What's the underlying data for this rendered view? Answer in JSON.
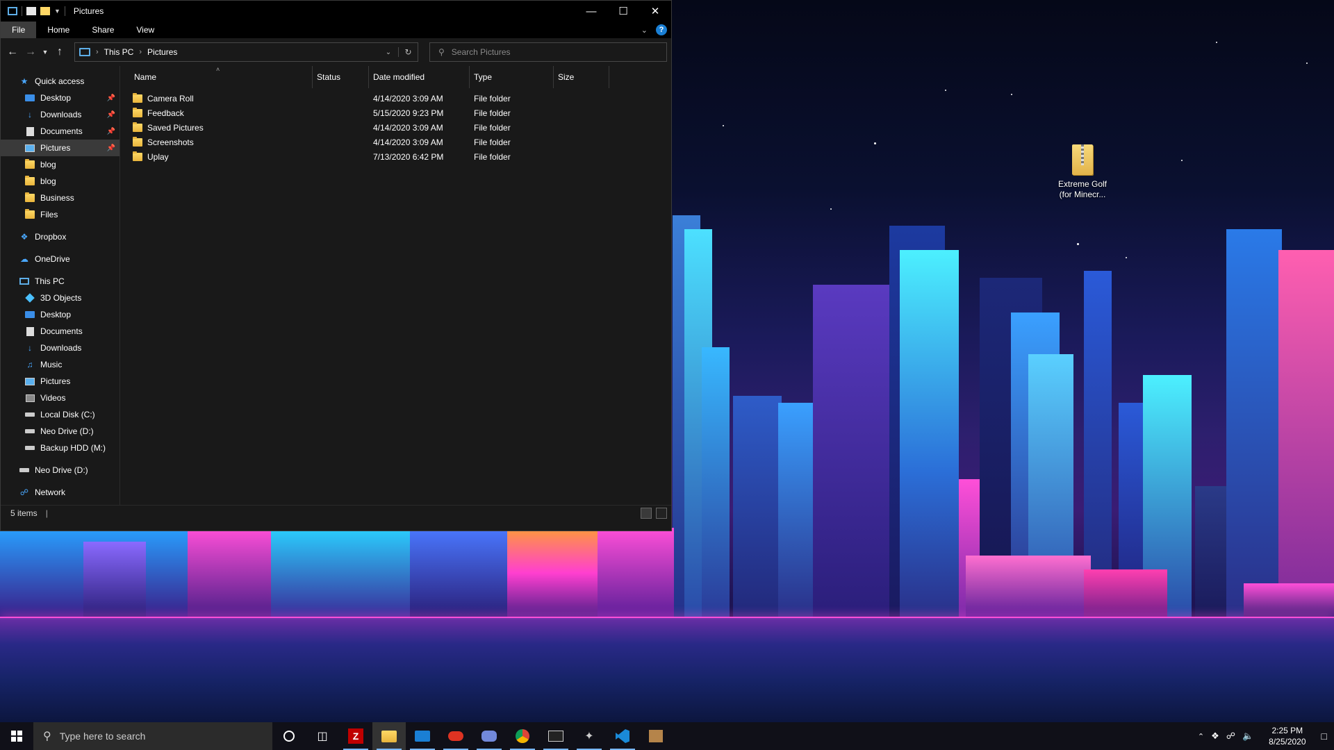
{
  "window": {
    "title": "Pictures",
    "ribbon_tabs": [
      "File",
      "Home",
      "Share",
      "View"
    ],
    "breadcrumb": [
      "This PC",
      "Pictures"
    ],
    "search_placeholder": "Search Pictures",
    "columns": [
      "Name",
      "Status",
      "Date modified",
      "Type",
      "Size"
    ],
    "files": [
      {
        "name": "Camera Roll",
        "date": "4/14/2020 3:09 AM",
        "type": "File folder",
        "size": ""
      },
      {
        "name": "Feedback",
        "date": "5/15/2020 9:23 PM",
        "type": "File folder",
        "size": ""
      },
      {
        "name": "Saved Pictures",
        "date": "4/14/2020 3:09 AM",
        "type": "File folder",
        "size": ""
      },
      {
        "name": "Screenshots",
        "date": "4/14/2020 3:09 AM",
        "type": "File folder",
        "size": ""
      },
      {
        "name": "Uplay",
        "date": "7/13/2020 6:42 PM",
        "type": "File folder",
        "size": ""
      }
    ],
    "status_text": "5 items"
  },
  "nav": {
    "quick_access": "Quick access",
    "quick_items": [
      {
        "label": "Desktop",
        "icon": "desktop-icon",
        "pinned": true
      },
      {
        "label": "Downloads",
        "icon": "download-icon",
        "pinned": true
      },
      {
        "label": "Documents",
        "icon": "document-icon",
        "pinned": true
      },
      {
        "label": "Pictures",
        "icon": "pictures-icon",
        "pinned": true,
        "selected": true
      },
      {
        "label": "blog",
        "icon": "folder-icon"
      },
      {
        "label": "blog",
        "icon": "folder-icon"
      },
      {
        "label": "Business",
        "icon": "folder-icon"
      },
      {
        "label": "Files",
        "icon": "folder-icon"
      }
    ],
    "dropbox": "Dropbox",
    "onedrive": "OneDrive",
    "this_pc": "This PC",
    "pc_items": [
      {
        "label": "3D Objects",
        "icon": "3d-objects-icon"
      },
      {
        "label": "Desktop",
        "icon": "desktop-icon"
      },
      {
        "label": "Documents",
        "icon": "document-icon"
      },
      {
        "label": "Downloads",
        "icon": "download-icon"
      },
      {
        "label": "Music",
        "icon": "music-icon"
      },
      {
        "label": "Pictures",
        "icon": "pictures-icon"
      },
      {
        "label": "Videos",
        "icon": "videos-icon"
      },
      {
        "label": "Local Disk (C:)",
        "icon": "drive-icon"
      },
      {
        "label": "Neo Drive (D:)",
        "icon": "drive-icon"
      },
      {
        "label": "Backup HDD (M:)",
        "icon": "drive-icon"
      }
    ],
    "neo_drive": "Neo Drive (D:)",
    "network": "Network"
  },
  "desktop_icon": {
    "line1": "Extreme Golf",
    "line2": "(for Minecr..."
  },
  "taskbar": {
    "search_placeholder": "Type here to search",
    "apps": [
      "cortana-icon",
      "task-view-icon",
      "filezilla-icon",
      "file-explorer-icon",
      "mail-icon",
      "pdf-app-icon",
      "discord-icon",
      "chrome-icon",
      "terminal-icon",
      "app-icon",
      "vscode-icon",
      "package-icon"
    ],
    "time": "2:25 PM",
    "date": "8/25/2020"
  },
  "colors": {
    "accent": "#1a7fd4",
    "window_bg": "#191919",
    "folder": "#ffd866"
  }
}
